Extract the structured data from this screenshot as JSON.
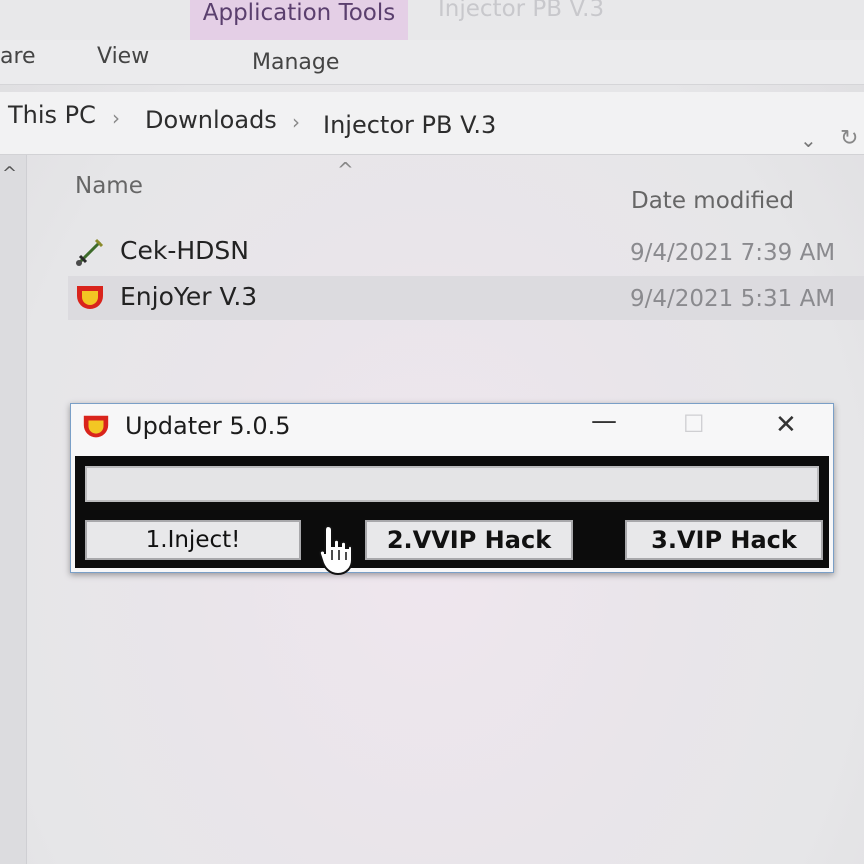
{
  "ribbon": {
    "context_tab": "Application Tools",
    "window_title": "Injector PB V.3",
    "tabs": [
      "are",
      "View",
      "Manage"
    ]
  },
  "address": {
    "crumbs": [
      "This PC",
      "Downloads",
      "Injector PB V.3"
    ],
    "separator": "›"
  },
  "list": {
    "columns": {
      "name": "Name",
      "date": "Date modified"
    },
    "files": [
      {
        "name": "Cek-HDSN",
        "date": "9/4/2021 7:39 AM",
        "icon": "sword-icon"
      },
      {
        "name": "EnjoYer V.3",
        "date": "9/4/2021 5:31 AM",
        "icon": "app-shield-icon"
      }
    ]
  },
  "dialog": {
    "title": "Updater 5.0.5",
    "minimize": "—",
    "maximize": "☐",
    "close": "✕",
    "buttons": [
      "1.Inject!",
      "2.VVIP Hack",
      "3.VIP Hack"
    ]
  },
  "colors": {
    "accent_context": "#e4cfe6",
    "dialog_border": "#7a9fc7",
    "shield_red": "#d9241c",
    "shield_yellow": "#f3c623"
  }
}
